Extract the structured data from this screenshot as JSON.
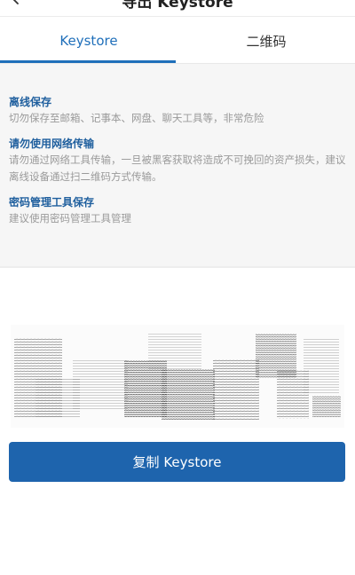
{
  "nav": {
    "title": "导出 Keystore",
    "back_icon": "chevron-left-icon"
  },
  "tabs": [
    {
      "label": "Keystore",
      "active": true
    },
    {
      "label": "二维码",
      "active": false
    }
  ],
  "info": [
    {
      "title": "离线保存",
      "text": "切勿保存至邮箱、记事本、网盘、聊天工具等，非常危险"
    },
    {
      "title": "请勿使用网络传输",
      "text": "请勿通过网络工具传输，一旦被黑客获取将造成不可挽回的资产损失，建议离线设备通过扫二维码方式传输。"
    },
    {
      "title": "密码管理工具保存",
      "text": "建议使用密码管理工具管理"
    }
  ],
  "copy_button": {
    "label": "复制 Keystore"
  },
  "colors": {
    "accent": "#1f6fba",
    "button": "#1e64ad",
    "info_title": "#1f5f9e",
    "info_text": "#9a9a9a",
    "panel_bg": "#f6f6f6"
  }
}
